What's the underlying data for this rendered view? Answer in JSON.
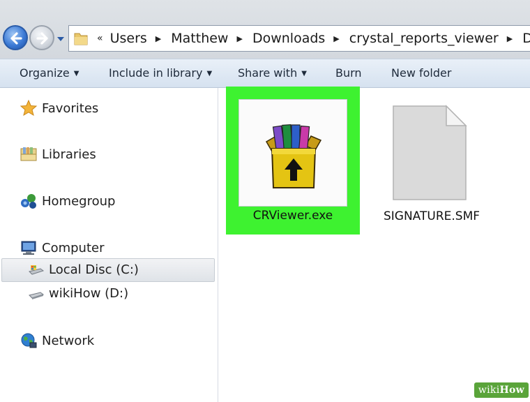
{
  "address_bar": {
    "overflow_chevron": "«",
    "separator": "▶",
    "path": [
      "Users",
      "Matthew",
      "Downloads",
      "crystal_reports_viewer",
      "DATA_U"
    ]
  },
  "toolbar": {
    "items": [
      {
        "label": "Organize",
        "has_menu": true
      },
      {
        "label": "Include in library",
        "has_menu": true
      },
      {
        "label": "Share with",
        "has_menu": true
      },
      {
        "label": "Burn",
        "has_menu": false
      },
      {
        "label": "New folder",
        "has_menu": false
      }
    ],
    "caret": "▼"
  },
  "sidebar": {
    "favorites": "Favorites",
    "libraries": "Libraries",
    "homegroup": "Homegroup",
    "computer": "Computer",
    "local_disc": "Local Disc (C:)",
    "wikihow_drive": "wikiHow (D:)",
    "network": "Network",
    "selected": "Local Disc (C:)"
  },
  "files": [
    {
      "name": "CRViewer.exe",
      "icon": "winrar-archive-icon",
      "highlighted": true,
      "highlight_color": "#3ef230"
    },
    {
      "name": "SIGNATURE.SMF",
      "icon": "blank-document-icon",
      "highlighted": false
    }
  ],
  "watermark": {
    "prefix": "wiki",
    "suffix": "How"
  }
}
